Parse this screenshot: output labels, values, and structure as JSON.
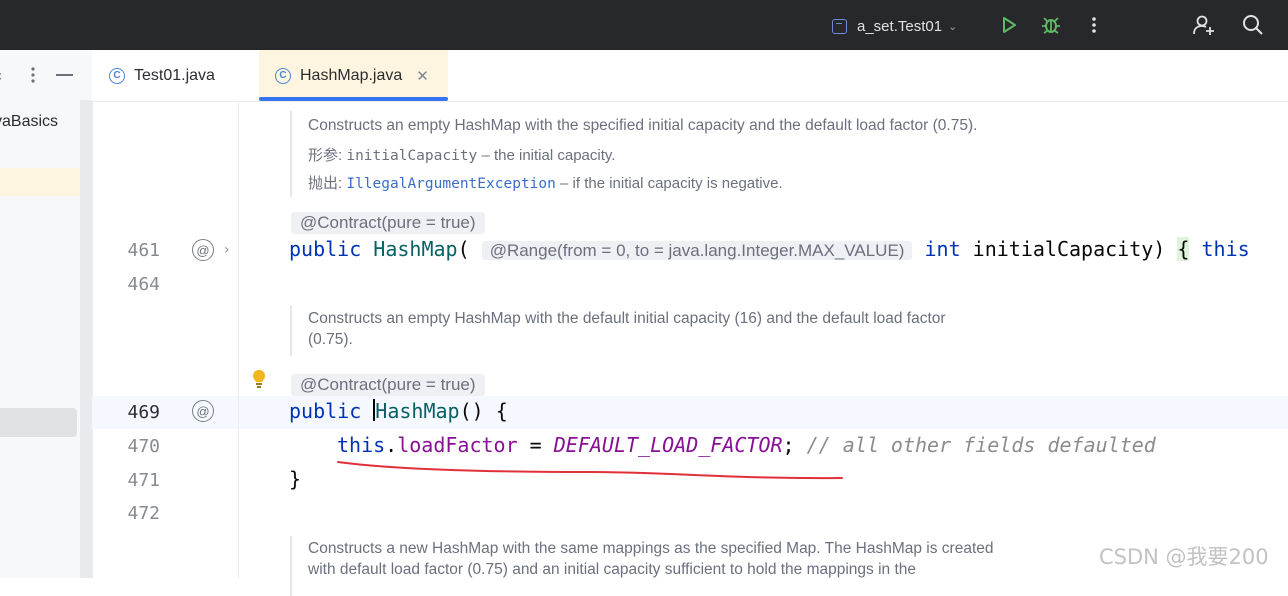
{
  "titlebar": {
    "run_config": "a_set.Test01",
    "icons": [
      "config-icon",
      "chevron-down-icon",
      "run-icon",
      "debug-icon",
      "more-icon",
      "add-user-icon",
      "search-icon"
    ],
    "colors": {
      "run": "#5fb865",
      "debug": "#5fb865",
      "bg": "#27282c"
    }
  },
  "project": {
    "visible_label": "vaBasics"
  },
  "tabs": [
    {
      "label": "Test01.java",
      "icon": "C",
      "active": false
    },
    {
      "label": "HashMap.java",
      "icon": "C",
      "active": true,
      "close": "✕"
    }
  ],
  "editor": {
    "lines": [
      "461",
      "464",
      "469",
      "470",
      "471",
      "472"
    ],
    "doc1": {
      "text": "Constructs an empty HashMap with the specified initial capacity and the default load factor (0.75).",
      "params_label": "形参:",
      "params_code": "initialCapacity",
      "params_text": "– the initial capacity.",
      "throws_label": "抛出:",
      "throws_code": "IllegalArgumentException",
      "throws_text": "– if the initial capacity is negative."
    },
    "anno1": "@Contract(pure = true)",
    "line461": {
      "kw": "public",
      "name": "HashMap",
      "open": "(",
      "range": "@Range(from = 0, to = java.lang.Integer.MAX_VALUE)",
      "int": "int",
      "param": "initialCapacity",
      "close": ")",
      "brace": "{",
      "this": "this"
    },
    "doc2": {
      "line1": "Constructs an empty HashMap with the default initial capacity (16) and the default load factor",
      "line2": "(0.75)."
    },
    "anno2": "@Contract(pure = true)",
    "line469": {
      "kw": "public",
      "name": "HashMap",
      "rest": "() {"
    },
    "line470": {
      "this": "this",
      "dot": ".",
      "field": "loadFactor",
      "eq": " = ",
      "const": "DEFAULT_LOAD_FACTOR",
      "semi": ";",
      "comment": "// all other fields defaulted"
    },
    "line471": "}",
    "doc3": {
      "line1": "Constructs a new HashMap with the same mappings as the specified Map. The HashMap is created",
      "line2": "with default load factor (0.75) and an initial capacity sufficient to hold the mappings in the"
    }
  },
  "watermark": "CSDN @我要200",
  "annotation_color": "#e0303a"
}
